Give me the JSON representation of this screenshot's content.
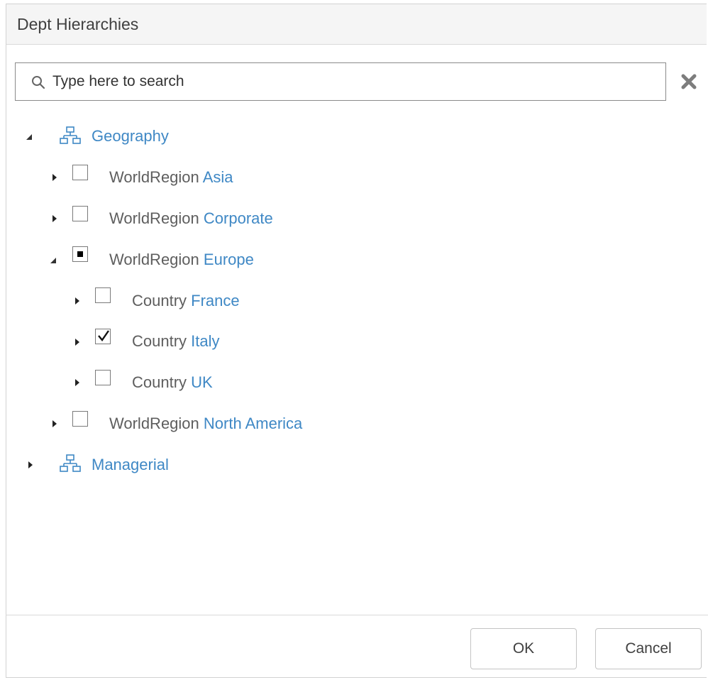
{
  "dialog": {
    "title": "Dept Hierarchies"
  },
  "search": {
    "placeholder": "Type here to search",
    "value": ""
  },
  "tree": {
    "geography": {
      "label": "Geography",
      "expanded": true,
      "items": {
        "asia": {
          "type": "WorldRegion",
          "name": "Asia",
          "state": "unchecked"
        },
        "corporate": {
          "type": "WorldRegion",
          "name": "Corporate",
          "state": "unchecked"
        },
        "europe": {
          "type": "WorldRegion",
          "name": "Europe",
          "state": "partial",
          "children": {
            "france": {
              "type": "Country",
              "name": "France",
              "state": "unchecked"
            },
            "italy": {
              "type": "Country",
              "name": "Italy",
              "state": "checked"
            },
            "uk": {
              "type": "Country",
              "name": "UK",
              "state": "unchecked"
            }
          }
        },
        "north_america": {
          "type": "WorldRegion",
          "name": "North America",
          "state": "unchecked"
        }
      }
    },
    "managerial": {
      "label": "Managerial",
      "expanded": false
    }
  },
  "footer": {
    "ok_label": "OK",
    "cancel_label": "Cancel"
  },
  "colors": {
    "link": "#3f88c5",
    "text": "#5e5e5e",
    "titlebar": "#f5f5f5"
  }
}
